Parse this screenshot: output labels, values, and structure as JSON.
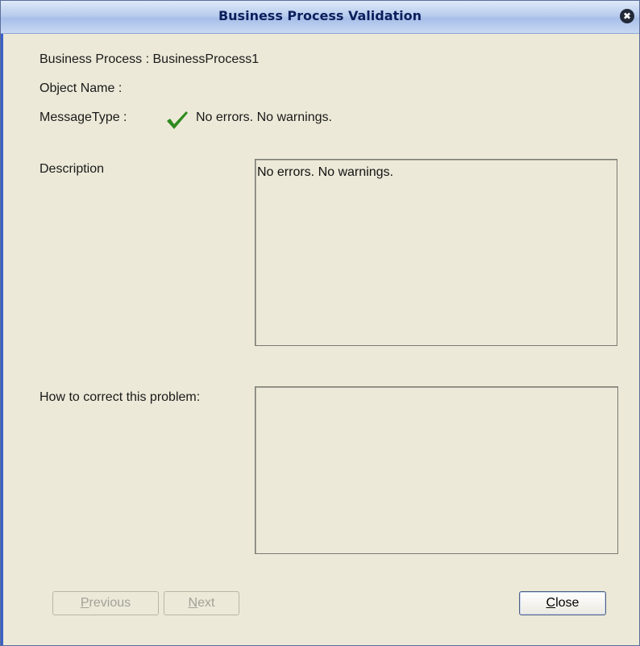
{
  "window": {
    "title": "Business Process Validation",
    "close_glyph": "✖",
    "close_icon": "close-icon"
  },
  "info": {
    "business_process": "Business Process : BusinessProcess1",
    "object_name": "Object Name :",
    "message_type_label": "MessageType :",
    "message_type_icon": "checkmark-icon",
    "message_type_value": "No errors. No warnings."
  },
  "description": {
    "label": "Description",
    "text": "No errors. No warnings."
  },
  "correction": {
    "label": "How to correct this problem:",
    "text": ""
  },
  "buttons": {
    "previous": {
      "mnemonic": "P",
      "rest": "revious",
      "enabled": false
    },
    "next": {
      "mnemonic": "N",
      "rest": "ext",
      "enabled": false
    },
    "close": {
      "mnemonic": "C",
      "rest": "lose",
      "enabled": true
    }
  },
  "colors": {
    "titlebar": "#b9cdee",
    "background": "#ece9d8",
    "check": "#2e8a1f"
  }
}
